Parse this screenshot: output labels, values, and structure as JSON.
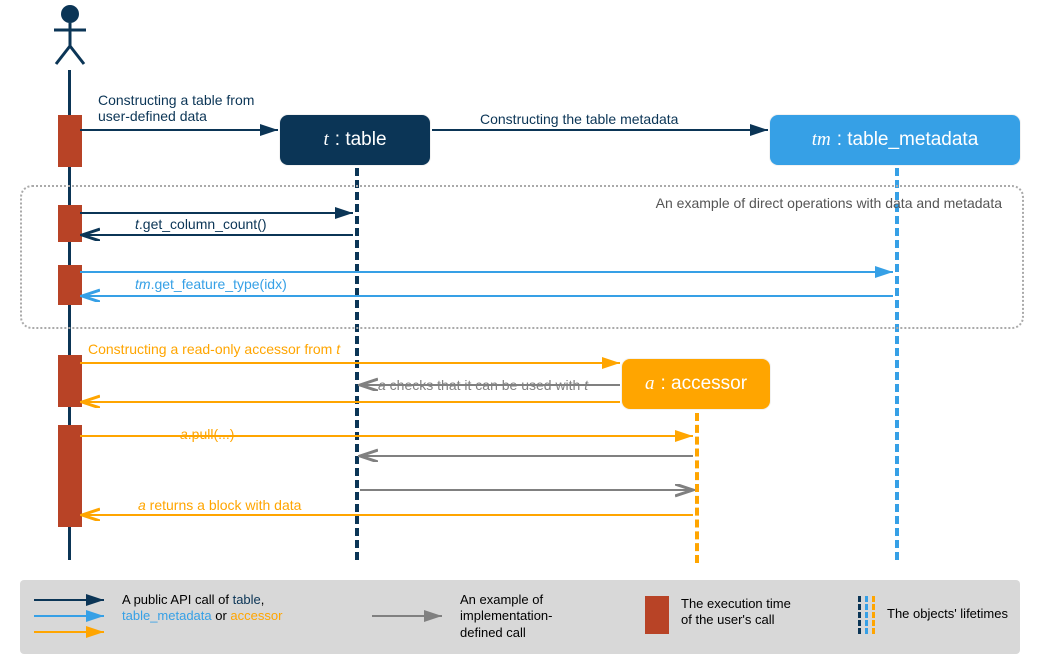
{
  "objects": {
    "table": {
      "var": "t",
      "type": "table"
    },
    "tm": {
      "var": "tm",
      "type": "table_metadata"
    },
    "acc": {
      "var": "a",
      "type": "accessor"
    }
  },
  "labels": {
    "construct_table_l1": "Constructing a table from",
    "construct_table_l2": "user-defined data",
    "construct_tm": "Constructing the table metadata",
    "get_col": ".get_column_count()",
    "get_col_var": "t",
    "get_feat": ".get_feature_type(idx)",
    "get_feat_var": "tm",
    "construct_acc": "Constructing a read-only accessor from ",
    "construct_acc_var": "t",
    "check_use": " checks that it can be used with ",
    "check_use_a": "a",
    "check_use_t": "t",
    "pull": ".pull(...)",
    "pull_var": "a",
    "returns": " returns a block with data",
    "returns_var": "a"
  },
  "region_title": "An example of direct operations with data and metadata",
  "legend": {
    "api_l1": "A public API call of ",
    "api_table": "table",
    "api_sep": ",",
    "api_tm": "table_metadata",
    "api_or": " or ",
    "api_acc": "accessor",
    "impl_l1": "An example of",
    "impl_l2": "implementation-",
    "impl_l3": "defined call",
    "exec_l1": "The execution time",
    "exec_l2": "of the user's call",
    "life": "The objects' lifetimes"
  }
}
